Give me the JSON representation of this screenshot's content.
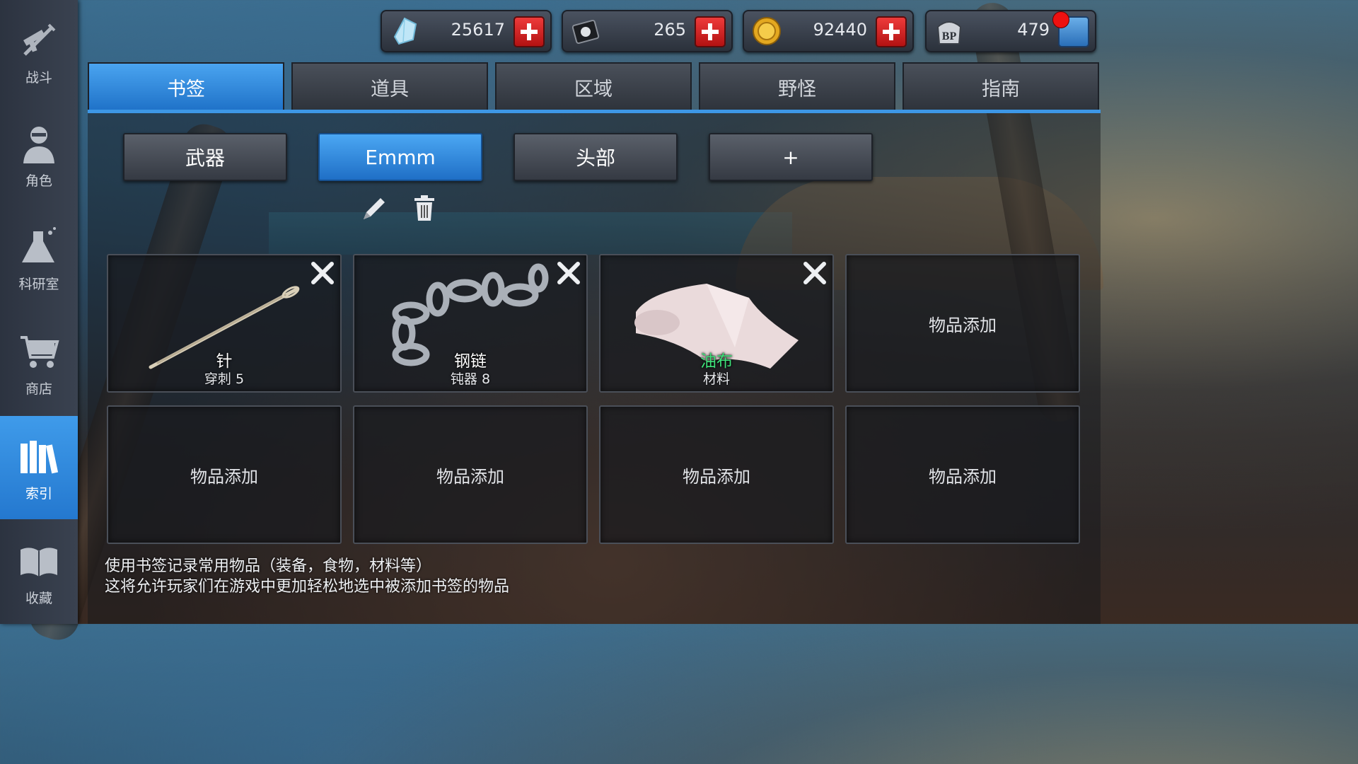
{
  "sidebar": {
    "items": [
      {
        "label": "战斗",
        "icon": "crossed-gun-sword-icon",
        "active": false
      },
      {
        "label": "角色",
        "icon": "character-portrait-icon",
        "active": false
      },
      {
        "label": "科研室",
        "icon": "flask-icon",
        "active": false
      },
      {
        "label": "商店",
        "icon": "shopping-cart-icon",
        "active": false
      },
      {
        "label": "索引",
        "icon": "books-icon",
        "active": true
      },
      {
        "label": "收藏",
        "icon": "open-book-icon",
        "active": false
      }
    ]
  },
  "resources": [
    {
      "icon": "crystal-icon",
      "value": "25617",
      "button": "plus"
    },
    {
      "icon": "disk-icon",
      "value": "265",
      "button": "plus"
    },
    {
      "icon": "gold-coin-icon",
      "value": "92440",
      "button": "plus"
    },
    {
      "icon": "bp-paw-icon",
      "value": "479",
      "button": "bp"
    }
  ],
  "tabs": [
    {
      "label": "书签",
      "active": true
    },
    {
      "label": "道具",
      "active": false
    },
    {
      "label": "区域",
      "active": false
    },
    {
      "label": "野怪",
      "active": false
    },
    {
      "label": "指南",
      "active": false
    }
  ],
  "bookmarks": [
    {
      "label": "武器",
      "active": false
    },
    {
      "label": "Emmm",
      "active": true
    },
    {
      "label": "头部",
      "active": false
    },
    {
      "label": "+",
      "active": false
    }
  ],
  "tools": {
    "edit_icon": "pencil-icon",
    "delete_icon": "trash-icon"
  },
  "slots": [
    {
      "name": "针",
      "sub": "穿刺 5",
      "icon": "needle-icon",
      "filled": true
    },
    {
      "name": "钢链",
      "sub": "钝器 8",
      "icon": "steel-chain-icon",
      "filled": true
    },
    {
      "name": "油布",
      "sub": "材料",
      "icon": "oilcloth-icon",
      "filled": true,
      "name_color": "#3fe07a"
    },
    {
      "name": "物品添加",
      "filled": false
    },
    {
      "name": "物品添加",
      "filled": false
    },
    {
      "name": "物品添加",
      "filled": false
    },
    {
      "name": "物品添加",
      "filled": false
    },
    {
      "name": "物品添加",
      "filled": false
    }
  ],
  "help": {
    "line1": "使用书签记录常用物品（装备，食物，材料等）",
    "line2": "这将允许玩家们在游戏中更加轻松地选中被添加书签的物品"
  }
}
